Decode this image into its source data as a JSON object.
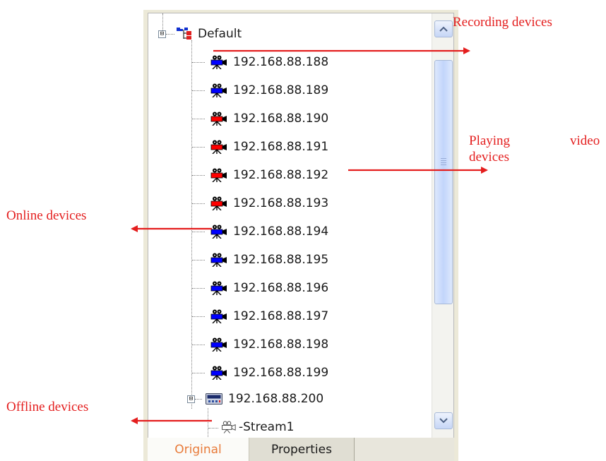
{
  "tree": {
    "root": {
      "label": "Default",
      "expander": "⊟",
      "icon": "group-tree-icon"
    },
    "devices": [
      {
        "label": "192.168.88.188",
        "color": "#0000ff",
        "status": "recording"
      },
      {
        "label": "192.168.88.189",
        "color": "#0000ff",
        "status": "online"
      },
      {
        "label": "192.168.88.190",
        "color": "#ff0000",
        "status": "playing"
      },
      {
        "label": "192.168.88.191",
        "color": "#ff0000",
        "status": "playing"
      },
      {
        "label": "192.168.88.192",
        "color": "#ff0000",
        "status": "playing"
      },
      {
        "label": "192.168.88.193",
        "color": "#ff0000",
        "status": "playing"
      },
      {
        "label": "192.168.88.194",
        "color": "#0000ff",
        "status": "online"
      },
      {
        "label": "192.168.88.195",
        "color": "#0000ff",
        "status": "online"
      },
      {
        "label": "192.168.88.196",
        "color": "#0000ff",
        "status": "online"
      },
      {
        "label": "192.168.88.197",
        "color": "#0000ff",
        "status": "online"
      },
      {
        "label": "192.168.88.198",
        "color": "#0000ff",
        "status": "online"
      },
      {
        "label": "192.168.88.199",
        "color": "#0000ff",
        "status": "online"
      }
    ],
    "nvr": {
      "label": "192.168.88.200",
      "expander": "⊟",
      "icon": "nvr-device-icon"
    },
    "stream": {
      "label": "-Stream1",
      "icon": "offline-camera-icon"
    }
  },
  "tabs": {
    "active": "Original",
    "inactive": "Properties"
  },
  "annotations": {
    "recording": "Recording devices",
    "playing_word1": "Playing",
    "playing_word2": "video",
    "playing_word3": "devices",
    "online": "Online devices",
    "offline": "Offline devices"
  },
  "colors": {
    "annotation": "#e41e1e",
    "active_tab_text": "#e87b3a",
    "camera_online": "#0000ff",
    "camera_playing": "#ff0000"
  }
}
